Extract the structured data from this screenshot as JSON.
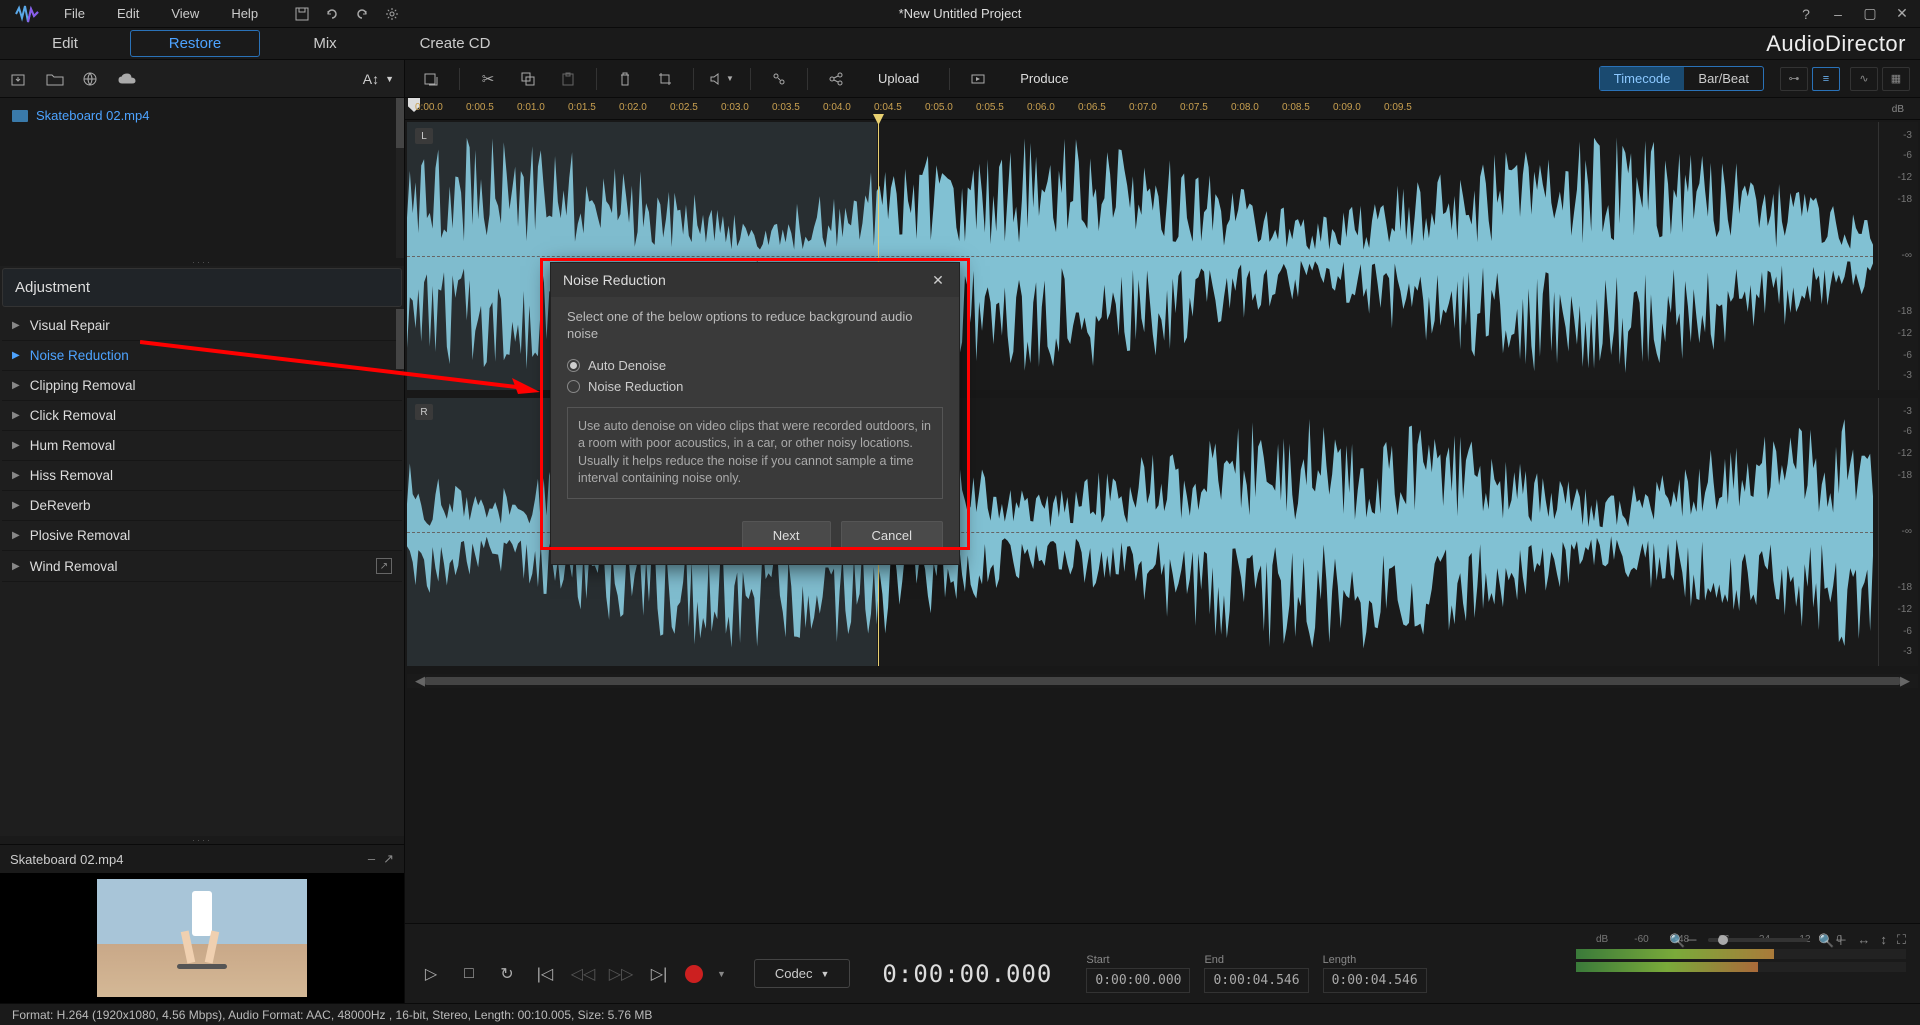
{
  "menubar": {
    "items": [
      "File",
      "Edit",
      "View",
      "Help"
    ]
  },
  "project_title": "*New Untitled Project",
  "main_tabs": {
    "items": [
      "Edit",
      "Restore",
      "Mix",
      "Create CD"
    ],
    "active_index": 1
  },
  "app_name": "AudioDirector",
  "left_toolbar": {
    "font_label": "A↕"
  },
  "file_list": {
    "items": [
      {
        "name": "Skateboard 02.mp4"
      }
    ]
  },
  "adjustment": {
    "header": "Adjustment",
    "items": [
      {
        "label": "Visual Repair",
        "active": false
      },
      {
        "label": "Noise Reduction",
        "active": true
      },
      {
        "label": "Clipping Removal",
        "active": false
      },
      {
        "label": "Click Removal",
        "active": false
      },
      {
        "label": "Hum Removal",
        "active": false
      },
      {
        "label": "Hiss Removal",
        "active": false
      },
      {
        "label": "DeReverb",
        "active": false
      },
      {
        "label": "Plosive Removal",
        "active": false
      },
      {
        "label": "Wind Removal",
        "active": false,
        "ext": true
      }
    ]
  },
  "preview": {
    "title": "Skateboard 02.mp4"
  },
  "right_toolbar": {
    "upload": "Upload",
    "produce": "Produce",
    "timecode": "Timecode",
    "barbeat": "Bar/Beat"
  },
  "ruler": {
    "ticks": [
      "0:00.0",
      "0:00.5",
      "0:01.0",
      "0:01.5",
      "0:02.0",
      "0:02.5",
      "0:03.0",
      "0:03.5",
      "0:04.0",
      "0:04.5",
      "0:05.0",
      "0:05.5",
      "0:06.0",
      "0:06.5",
      "0:07.0",
      "0:07.5",
      "0:08.0",
      "0:08.5",
      "0:09.0",
      "0:09.5"
    ]
  },
  "channels": {
    "left_label": "L",
    "right_label": "R"
  },
  "db_scale": {
    "header": "dB",
    "labels": [
      "-3",
      "-6",
      "-12",
      "-18",
      "-∞",
      "-18",
      "-12",
      "-6",
      "-3"
    ]
  },
  "transport": {
    "codec": "Codec",
    "time": "0:00:00.000",
    "start_label": "Start",
    "start_val": "0:00:00.000",
    "end_label": "End",
    "end_val": "0:00:04.546",
    "length_label": "Length",
    "length_val": "0:00:04.546"
  },
  "meter": {
    "header": "dB",
    "labels": [
      "-60",
      "-48",
      "-36",
      "-24",
      "-12",
      "0"
    ]
  },
  "statusbar": {
    "text": "Format: H.264 (1920x1080, 4.56 Mbps), Audio Format: AAC, 48000Hz , 16-bit, Stereo, Length: 00:10.005, Size: 5.76 MB"
  },
  "dialog": {
    "title": "Noise Reduction",
    "instruction": "Select one of the below options to reduce background audio noise",
    "options": [
      {
        "label": "Auto Denoise",
        "checked": true
      },
      {
        "label": "Noise Reduction",
        "checked": false
      }
    ],
    "description": "Use auto denoise on video clips that were recorded outdoors, in a room with poor acoustics, in a car, or other noisy locations. Usually it helps reduce the noise if you cannot sample a time interval containing noise only.",
    "next": "Next",
    "cancel": "Cancel"
  }
}
